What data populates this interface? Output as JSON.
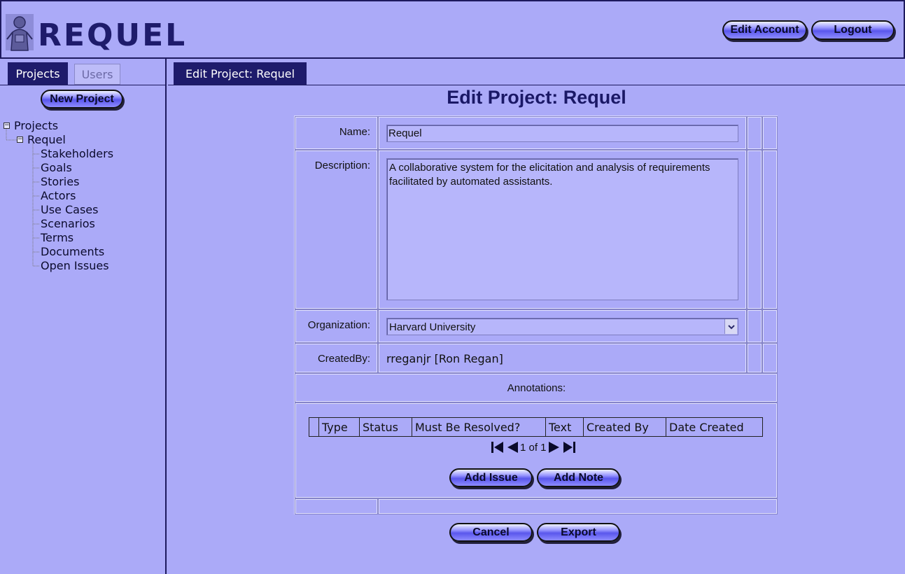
{
  "app": {
    "logo_text": "REQUEL"
  },
  "header": {
    "edit_account": "Edit Account",
    "logout": "Logout"
  },
  "sidebar": {
    "tabs": [
      {
        "label": "Projects",
        "active": true
      },
      {
        "label": "Users",
        "active": false
      }
    ],
    "new_project": "New Project",
    "tree": {
      "root": "Projects",
      "project": "Requel",
      "items": [
        "Stakeholders",
        "Goals",
        "Stories",
        "Actors",
        "Use Cases",
        "Scenarios",
        "Terms",
        "Documents",
        "Open Issues"
      ]
    }
  },
  "main": {
    "tab": "Edit Project: Requel",
    "title": "Edit Project: Requel",
    "form": {
      "name_label": "Name:",
      "name_value": "Requel",
      "description_label": "Description:",
      "description_value": "A collaborative system for the elicitation and analysis of requirements  facilitated by automated assistants.",
      "organization_label": "Organization:",
      "organization_value": "Harvard University",
      "createdby_label": "CreatedBy:",
      "createdby_value": "rreganjr [Ron Regan]",
      "annotations_label": "Annotations:",
      "annotation_columns": [
        "Type",
        "Status",
        "Must Be Resolved?",
        "Text",
        "Created By",
        "Date Created"
      ],
      "pager_text": "1 of 1",
      "add_issue": "Add Issue",
      "add_note": "Add Note"
    },
    "cancel": "Cancel",
    "export": "Export"
  },
  "colors": {
    "background": "#abaaf8",
    "tab_active": "#1e1b6b",
    "title": "#1a1866"
  }
}
